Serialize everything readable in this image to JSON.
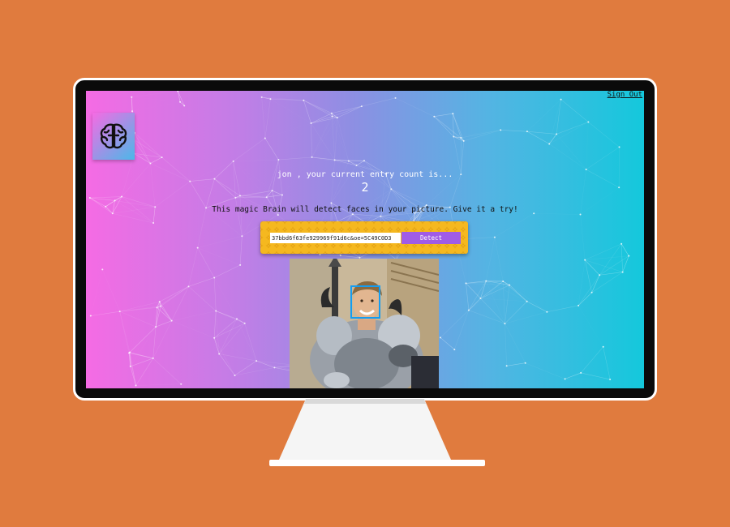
{
  "header": {
    "signout_label": "Sign Out"
  },
  "logo": {
    "icon": "brain-icon"
  },
  "rank": {
    "message": "jon , your current entry count is...",
    "count": "2"
  },
  "tagline": "This magic Brain will detect faces in your picture. Give it a try!",
  "form": {
    "input_value": "37bbd6f63fe929969f91d6c&oe=5C49C0D3",
    "detect_label": "Detect"
  },
  "colors": {
    "background": "#e07b3e",
    "gradient_start": "#f56be4",
    "gradient_end": "#14c8dc",
    "form_panel": "#f5b81f",
    "detect_button": "#a05ce6",
    "bounding_box": "#149df2"
  }
}
